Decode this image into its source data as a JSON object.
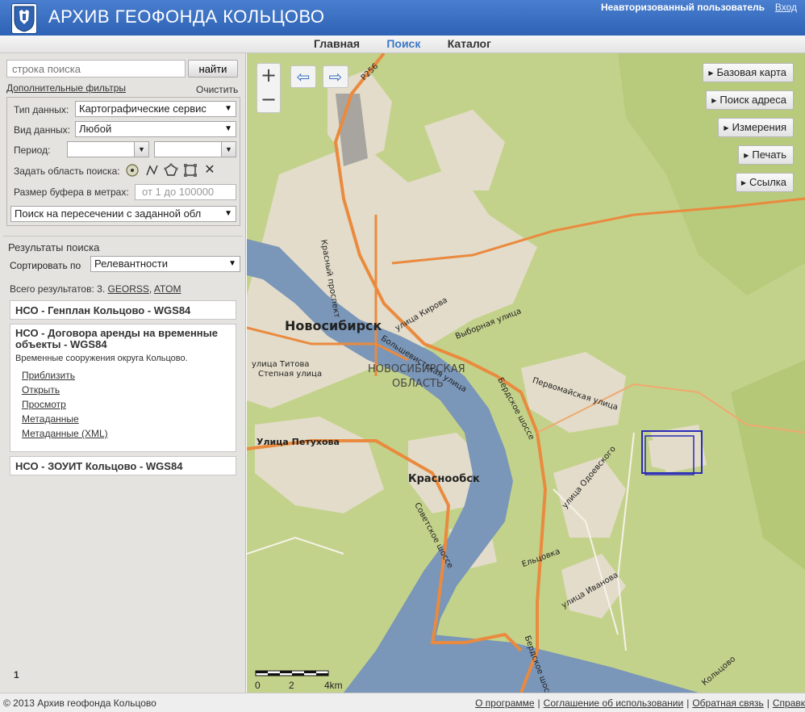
{
  "header": {
    "site_title": "АРХИВ ГЕОФОНДА КОЛЬЦОВО",
    "user_label": "Неавторизованный пользователь",
    "login_label": "Вход",
    "bg_color": "#3b6fc2"
  },
  "nav": {
    "items": [
      {
        "label": "Главная"
      },
      {
        "label": "Поиск"
      },
      {
        "label": "Каталог"
      }
    ],
    "active": "Поиск",
    "active_color": "#3b78c8"
  },
  "search": {
    "placeholder": "строка поиска",
    "button_label": "найти",
    "filters_link": "Дополнительные фильтры",
    "clear_link": "Очистить"
  },
  "filters": {
    "data_type_label": "Тип данных:",
    "data_type_value": "Картографические сервис",
    "data_kind_label": "Вид данных:",
    "data_kind_value": "Любой",
    "period_label": "Период:",
    "area_label": "Задать область поиска:",
    "area_tools": [
      "point-tool-icon",
      "line-tool-icon",
      "polygon-tool-icon",
      "rectangle-tool-icon",
      "clear-tool-icon"
    ],
    "buffer_label": "Размер буфера в метрах:",
    "buffer_placeholder": "от 1 до 100000",
    "intersection_value": "Поиск на пересечении с заданной обл"
  },
  "results": {
    "title": "Результаты поиска",
    "sort_label": "Сортировать по",
    "sort_value": "Релевантности",
    "total_prefix": "Всего результатов: 3.",
    "feeds": [
      "GEORSS",
      "ATOM"
    ],
    "items": [
      {
        "title": "НСО - Генплан Кольцово - WGS84"
      },
      {
        "title": "НСО - Договора аренды на временные объекты - WGS84",
        "description": "Временные сооружения округа Кольцово.",
        "links": [
          "Приблизить",
          "Открыть",
          "Просмотр",
          "Метаданные",
          "Метаданные (XML)"
        ]
      },
      {
        "title": "НСО - ЗОУИТ Кольцово - WGS84"
      }
    ],
    "page": "1"
  },
  "map": {
    "zoom_in": "+",
    "zoom_out": "−",
    "buttons": [
      "Базовая карта",
      "Поиск адреса",
      "Измерения",
      "Печать",
      "Ссылка"
    ],
    "labels": {
      "city": "Новосибирск",
      "region_1": "НОВОСИБИРСКАЯ",
      "region_2": "ОБЛАСТЬ",
      "town": "Краснообск",
      "r256": "Р256",
      "st_petukhova": "Улица Петухова",
      "krasny_prospekt": "Красный проспект",
      "bolshevistskaya": "Большевистская улица",
      "berdskoe": "Бердское шоссе",
      "berdskoe_2": "Бердское шоссе",
      "sovetskoe": "Советское шоссе",
      "titova": "улица Титова",
      "stepnaya": "Степная улица",
      "kirova": "улица Кирова",
      "vybornaya": "Выборная улица",
      "pervomayskaya": "Первомайская улица",
      "odoevskogo": "улица Одоевского",
      "ivanova": "улица Иванова",
      "elcovka": "Ельцовка",
      "kolcovo": "Кольцово"
    },
    "scale_labels": [
      "0",
      "2",
      "4km"
    ],
    "colors": {
      "land": "#c3d28b",
      "urban": "#e3dcca",
      "water": "#7a96b8",
      "road": "#ea8a3e",
      "selection": "#2a2bb8"
    }
  },
  "footer": {
    "copyright": "© 2013 Архив геофонда Кольцово",
    "links": [
      "О программе",
      "Соглашение об использовании",
      "Обратная связь",
      "Справк"
    ]
  }
}
